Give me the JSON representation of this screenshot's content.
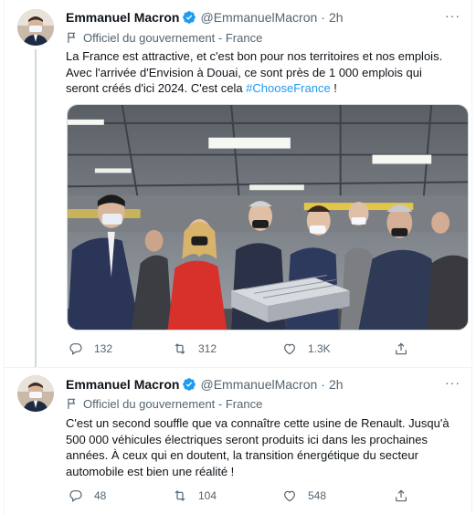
{
  "tweets": [
    {
      "author_name": "Emmanuel Macron",
      "handle": "@EmmanuelMacron",
      "time": "2h",
      "separator": "·",
      "more": "···",
      "label": "Officiel du gouvernement - France",
      "text_lines": [
        "La France est attractive, et c'est bon pour nos territoires et nos emplois.",
        "Avec l'arrivée d'Envision à Douai, ce sont près de 1 000 emplois qui",
        "seront créés d'ici 2024. C'est cela "
      ],
      "hashtag": "#ChooseFrance",
      "text_end": " !",
      "replies": "132",
      "retweets": "312",
      "likes": "1.3K"
    },
    {
      "author_name": "Emmanuel Macron",
      "handle": "@EmmanuelMacron",
      "time": "2h",
      "separator": "·",
      "more": "···",
      "label": "Officiel du gouvernement - France",
      "text_lines": [
        "C'est un second souffle que va connaître cette usine de Renault. Jusqu'à",
        "500 000 véhicules électriques seront produits ici dans les prochaines",
        "années. À ceux qui en doutent, la transition énergétique du secteur",
        "automobile est bien une réalité !"
      ],
      "replies": "48",
      "retweets": "104",
      "likes": "548"
    }
  ],
  "icons": {
    "verified": "verified-badge-icon",
    "label": "flag-icon",
    "reply": "reply-icon",
    "retweet": "retweet-icon",
    "like": "heart-icon",
    "share": "share-icon"
  },
  "colors": {
    "accent": "#1d9bf0",
    "text": "#0f1419",
    "secondary": "#536471",
    "border": "#eff3f4"
  }
}
